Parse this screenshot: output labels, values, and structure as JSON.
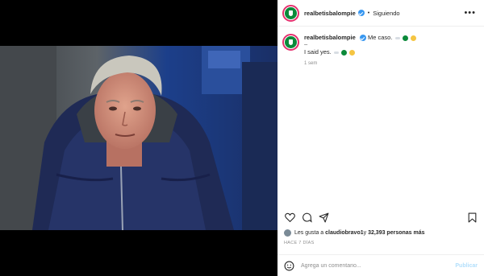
{
  "post": {
    "username": "realbetisbalompie",
    "follow_status": "Siguiendo",
    "more_label": "•••",
    "caption_text": "Me caso.",
    "caption_dashes": "--",
    "caption_second": "I said yes.",
    "time_ago": "1 sem",
    "liked_by_prefix": "Les gusta a ",
    "liked_by_user": "claudiobravo1",
    "liked_by_mid": " y ",
    "liked_by_count": "32,393 personas más",
    "posted_ago": "HACE 7 DÍAS",
    "comment_placeholder": "Agrega un comentario...",
    "publish_label": "Publicar"
  },
  "icons": {
    "like": "heart-icon",
    "comment": "comment-icon",
    "share": "paper-plane-icon",
    "save": "bookmark-icon",
    "emoji": "smiley-icon"
  },
  "colors": {
    "verified": "#3897f0",
    "club_green": "#0b8a3a",
    "publish": "#b2dffc"
  }
}
